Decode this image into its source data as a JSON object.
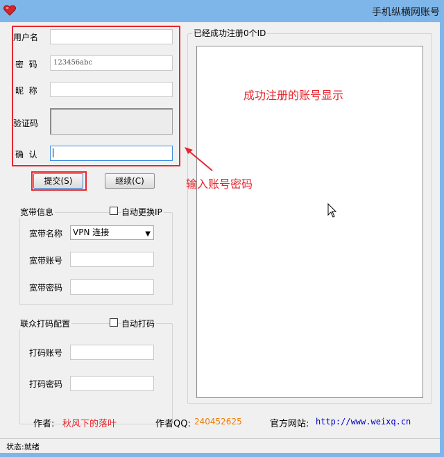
{
  "window": {
    "title": "手机纵横网账号",
    "icon": "heart-icon",
    "accent": "#7fb6ea"
  },
  "form": {
    "username_label": "用户名",
    "username_value": "",
    "password_label": "密  码",
    "password_value": "123456abc",
    "nickname_label": "昵  称",
    "nickname_value": "",
    "captcha_label": "验证码",
    "confirm_label": "确  认",
    "confirm_value": ""
  },
  "buttons": {
    "submit": "提交(S)",
    "continue": "继续(C)"
  },
  "broadband": {
    "group_title": "宽带信息",
    "auto_ip_label": "自动更换IP",
    "auto_ip_checked": false,
    "name_label": "宽带名称",
    "name_value": "VPN 连接",
    "account_label": "宽带账号",
    "account_value": "",
    "password_label": "宽带密码",
    "password_value": ""
  },
  "captcha_service": {
    "group_title": "联众打码配置",
    "auto_label": "自动打码",
    "auto_checked": false,
    "account_label": "打码账号",
    "account_value": "",
    "password_label": "打码密码",
    "password_value": ""
  },
  "results": {
    "group_title": "已经成功注册0个ID",
    "items": []
  },
  "annotations": {
    "list_note": "成功注册的账号显示",
    "input_note": "输入账号密码",
    "color": "#e8262d"
  },
  "footer": {
    "author_label": "作者:",
    "author_value": "秋风下的落叶",
    "qq_label": "作者QQ:",
    "qq_value": "240452625",
    "site_label": "官方网站:",
    "site_value": "http://www.weixq.cn",
    "author_color": "#e8262d",
    "qq_color": "#f07c00",
    "site_color": "#0000c8"
  },
  "status": {
    "text": "状态:就绪"
  }
}
